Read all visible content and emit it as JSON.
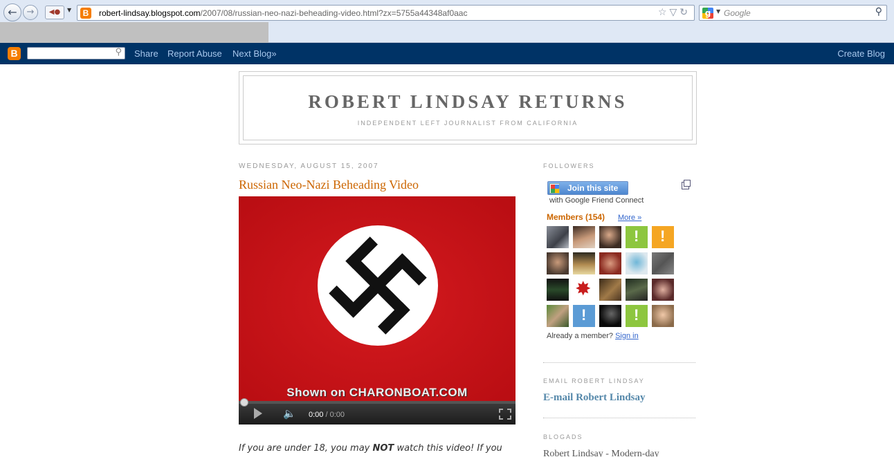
{
  "browser": {
    "url_host": "robert-lindsay.blogspot.com",
    "url_path": "/2007/08/russian-neo-nazi-beheading-video.html?zx=5755a44348af0aac",
    "search_placeholder": "Google",
    "url_icons": "☆▽↻"
  },
  "navbar": {
    "share": "Share",
    "report_abuse": "Report Abuse",
    "next_blog": "Next Blog»",
    "create_blog": "Create Blog"
  },
  "header": {
    "title": "ROBERT LINDSAY RETURNS",
    "description": "INDEPENDENT LEFT JOURNALIST FROM CALIFORNIA"
  },
  "post": {
    "date": "WEDNESDAY, AUGUST 15, 2007",
    "title": "Russian Neo-Nazi Beheading Video",
    "video": {
      "watermark": "Shown on CHARONBOAT.COM",
      "time_current": "0:00",
      "time_separator": " / ",
      "time_total": "0:00"
    },
    "body_prefix": "If you are under 18, you may ",
    "body_bold": "NOT",
    "body_suffix": " watch this video! If you"
  },
  "sidebar": {
    "followers_heading": "FOLLOWERS",
    "join_label": "Join this site",
    "join_sub": "with Google Friend Connect",
    "members_title": "Members (154)",
    "more_link": "More »",
    "already_member": "Already a member?",
    "sign_in": "Sign in",
    "email_heading": "EMAIL ROBERT LINDSAY",
    "email_link": "E-mail Robert Lindsay",
    "blogads_heading": "BLOGADS",
    "blogads_text": "Robert Lindsay - Modern-day"
  },
  "colors": {
    "navbar_bg": "#003366",
    "link_orange": "#cc6600",
    "video_red": "#cc0f15",
    "placeholder_green": "#8dc63f",
    "placeholder_orange": "#f5a623",
    "placeholder_blue": "#5b9bd5"
  }
}
